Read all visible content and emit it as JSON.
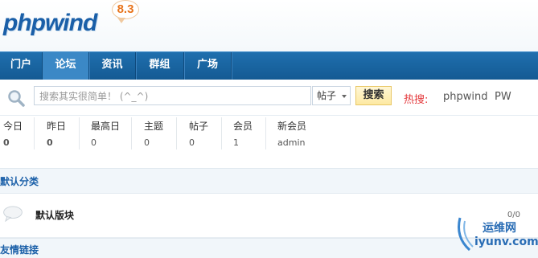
{
  "logo": {
    "text": "phpwind",
    "version": "8.3"
  },
  "nav": {
    "items": [
      "门户",
      "论坛",
      "资讯",
      "群组",
      "广场"
    ],
    "active": "论坛"
  },
  "search": {
    "placeholder": "搜索其实很简单！ (^_^)",
    "type": "帖子",
    "button": "搜索",
    "hot_label": "热搜:",
    "hot_links": [
      "phpwind",
      "PW"
    ]
  },
  "stats": [
    {
      "label": "今日",
      "value": "0",
      "bold": true
    },
    {
      "label": "昨日",
      "value": "0",
      "bold": true
    },
    {
      "label": "最高日",
      "value": "0",
      "bold": false
    },
    {
      "label": "主题",
      "value": "0",
      "bold": false
    },
    {
      "label": "帖子",
      "value": "0",
      "bold": false
    },
    {
      "label": "会员",
      "value": "1",
      "bold": false
    },
    {
      "label": "新会员",
      "value": "admin",
      "bold": false
    }
  ],
  "category": {
    "title": "默认分类"
  },
  "forum": {
    "name": "默认版块",
    "count": "0/0"
  },
  "links": {
    "title": "友情链接"
  },
  "watermark": {
    "line1": "运维网",
    "line2": "iyunv.com"
  },
  "colors": {
    "brand": "#1a5fa8",
    "nav": "#1f6fae",
    "hot": "#e4393c",
    "badge": "#e8731a"
  }
}
